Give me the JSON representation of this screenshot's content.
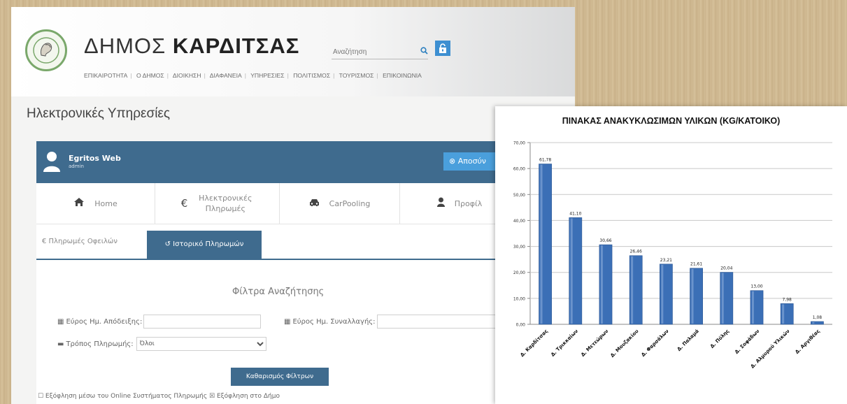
{
  "site": {
    "title_light": "ΔΗΜΟΣ",
    "title_bold": "ΚΑΡΔΙΤΣΑΣ",
    "search_placeholder": "Αναζήτηση",
    "nav": [
      "ΕΠΙΚΑΙΡΟΤΗΤΑ",
      "Ο ΔΗΜΟΣ",
      "ΔΙΟΙΚΗΣΗ",
      "ΔΙΑΦΑΝΕΙΑ",
      "ΥΠΗΡΕΣΙΕΣ",
      "ΠΟΛΙΤΙΣΜΟΣ",
      "ΤΟΥΡΙΣΜΟΣ",
      "ΕΠΙΚΟΙΝΩΝΙΑ"
    ]
  },
  "page": {
    "heading": "Ηλεκτρονικές Υπηρεσίες"
  },
  "user": {
    "name": "Egritos Web",
    "role": "admin",
    "logout_label": "⊗ Αποσύν"
  },
  "tabs": [
    {
      "icon": "home-icon",
      "label": "Home"
    },
    {
      "icon": "euro-icon",
      "label": "Ηλεκτρονικές Πληρωμές"
    },
    {
      "icon": "car-icon",
      "label": "CarPooling"
    },
    {
      "icon": "user-icon",
      "label": "Προφίλ"
    }
  ],
  "subtabs": {
    "debts_label": "€ Πληρωμές Οφειλών",
    "history_label": "↺ Ιστορικό Πληρωμών"
  },
  "filters": {
    "title": "Φίλτρα Αναζήτησης",
    "receipt_range_label": "Εύρος Ημ. Απόδειξης:",
    "transaction_range_label": "Εύρος Ημ. Συναλλαγής:",
    "payment_method_label": "Τρόπος Πληρωμής:",
    "payment_method_value": "Όλοι",
    "clear_button": "Καθαρισμός Φίλτρων",
    "bottom_text": "☐ Εξόφληση μέσω του Online Συστήματος Πληρωμής   ☒ Εξόφληση στο Δήμο"
  },
  "chart_data": {
    "type": "bar",
    "title": "ΠΙΝΑΚΑΣ ΑΝΑΚΥΚΛΩΣΙΜΩΝ ΥΛΙΚΩΝ (KG/ΚΑΤΟΙΚΟ)",
    "categories": [
      "Δ. Καρδίτσας",
      "Δ. Τρικκαίων",
      "Δ. Μετεώρων",
      "Δ. Μουζακίου",
      "Δ. Φαρσάλων",
      "Δ. Παλαμά",
      "Δ. Πύλης",
      "Δ. Σοφάδων",
      "Δ. Αλμυρού Υλικών",
      "Δ. Αργιθέας"
    ],
    "values": [
      61.78,
      41.1,
      30.66,
      26.46,
      23.21,
      21.61,
      20.04,
      13.0,
      7.98,
      1.08
    ],
    "value_labels": [
      "61,78",
      "41,10",
      "30,66",
      "26,46",
      "23,21",
      "21,61",
      "20,04",
      "13,00",
      "7,98",
      "1,08"
    ],
    "yticks": [
      "0,00",
      "10,00",
      "20,00",
      "30,00",
      "40,00",
      "50,00",
      "60,00",
      "70,00"
    ],
    "ylim": [
      0,
      70
    ],
    "bar_color": "#3b6fb6",
    "grid": true
  }
}
